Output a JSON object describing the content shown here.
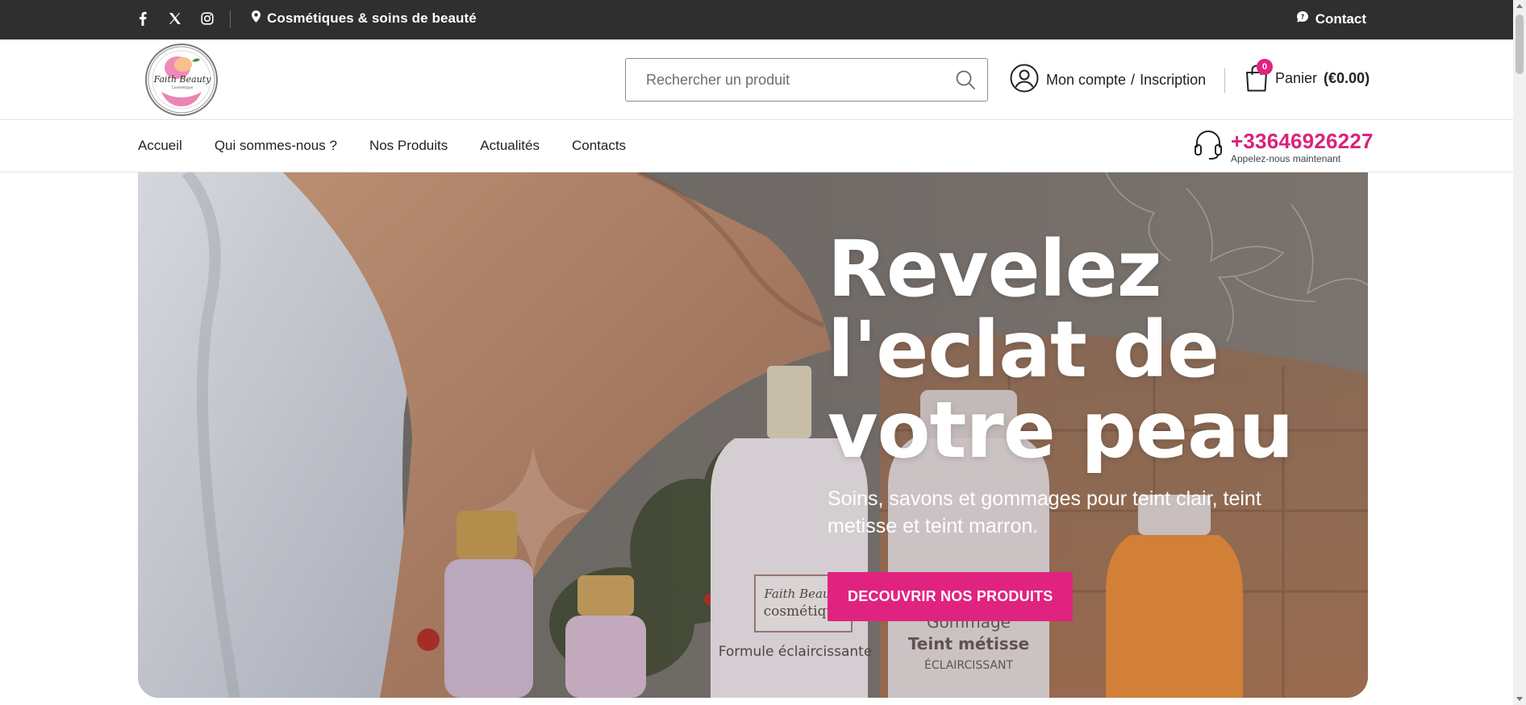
{
  "topbar": {
    "tagline": "Cosmétiques & soins de beauté",
    "contact": "Contact",
    "social_icons": [
      "facebook-icon",
      "x-icon",
      "instagram-icon"
    ]
  },
  "header": {
    "logo_text": "Faith Beauty",
    "logo_subtext": "Cosmétique",
    "search_placeholder": "Rechercher un produit",
    "account_label": "Mon compte",
    "account_sep": "/",
    "register_label": "Inscription",
    "cart_label": "Panier",
    "cart_total": "(€0.00)",
    "cart_count": "0"
  },
  "nav": {
    "items": [
      {
        "label": "Accueil"
      },
      {
        "label": "Qui sommes-nous ?"
      },
      {
        "label": "Nos Produits"
      },
      {
        "label": "Actualités"
      },
      {
        "label": "Contacts"
      }
    ],
    "phone": "+33646926227",
    "phone_sub": "Appelez-nous maintenant"
  },
  "hero": {
    "title_line1": "Revelez",
    "title_line2": "l'eclat de",
    "title_line3": "votre peau",
    "subtitle": "Soins, savons et gommages pour teint clair, teint metisse et teint marron.",
    "button": "DECOUVRIR NOS PRODUITS",
    "product_label_1": "Faith Beauté",
    "product_label_2": "cosmétique",
    "product_label_3": "Formule éclaircissante",
    "product_label_4": "Gommage",
    "product_label_5": "Teint métisse",
    "product_label_6": "ÉCLAIRCISSANT"
  },
  "colors": {
    "accent": "#e0237f",
    "topbar_bg": "#2f2f30"
  }
}
